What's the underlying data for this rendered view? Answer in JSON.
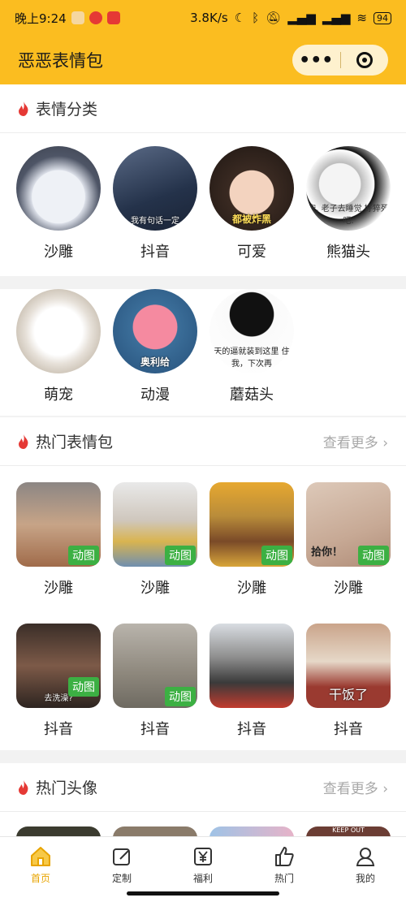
{
  "status_bar": {
    "time": "晚上9:24",
    "speed": "3.8K/s",
    "battery": "94"
  },
  "header": {
    "title": "恶恶表情包",
    "more_icon": "more-dots-icon",
    "close_icon": "target-icon"
  },
  "categories": {
    "title": "表情分类",
    "items": [
      {
        "label": "沙雕",
        "caption": ""
      },
      {
        "label": "抖音",
        "caption": "我有句话一定"
      },
      {
        "label": "可爱",
        "caption": "都被炸黑"
      },
      {
        "label": "熊猫头",
        "caption": "安, 老子去睡觉 好猝死吧."
      },
      {
        "label": "萌宠",
        "caption": ""
      },
      {
        "label": "动漫",
        "caption": "奥利给"
      },
      {
        "label": "蘑菇头",
        "caption": "天的逼就装到这里 住我，下次再"
      }
    ]
  },
  "hot_stickers": {
    "title": "热门表情包",
    "more": "查看更多",
    "items": [
      {
        "label": "沙雕",
        "badge": "动图",
        "caption": ""
      },
      {
        "label": "沙雕",
        "badge": "动图",
        "caption": ""
      },
      {
        "label": "沙雕",
        "badge": "动图",
        "caption": ""
      },
      {
        "label": "沙雕",
        "badge": "动图",
        "caption": "拾你！"
      },
      {
        "label": "抖音",
        "badge": "动图",
        "caption": "去洗澡?"
      },
      {
        "label": "抖音",
        "badge": "动图",
        "caption": ""
      },
      {
        "label": "抖音",
        "badge": "",
        "caption": ""
      },
      {
        "label": "抖音",
        "badge": "",
        "caption": "干饭了"
      }
    ]
  },
  "hot_avatars": {
    "title": "热门头像",
    "more": "查看更多",
    "peek_caption": "KEEP OUT"
  },
  "tabbar": {
    "items": [
      {
        "label": "首页",
        "icon": "home-icon"
      },
      {
        "label": "定制",
        "icon": "edit-icon"
      },
      {
        "label": "福利",
        "icon": "yen-icon"
      },
      {
        "label": "热门",
        "icon": "thumbs-up-icon"
      },
      {
        "label": "我的",
        "icon": "user-icon"
      }
    ],
    "active_color": "#e8a400"
  },
  "colors": {
    "brand": "#fbbd20",
    "badge": "#3cb043",
    "fire": "#e53935"
  }
}
